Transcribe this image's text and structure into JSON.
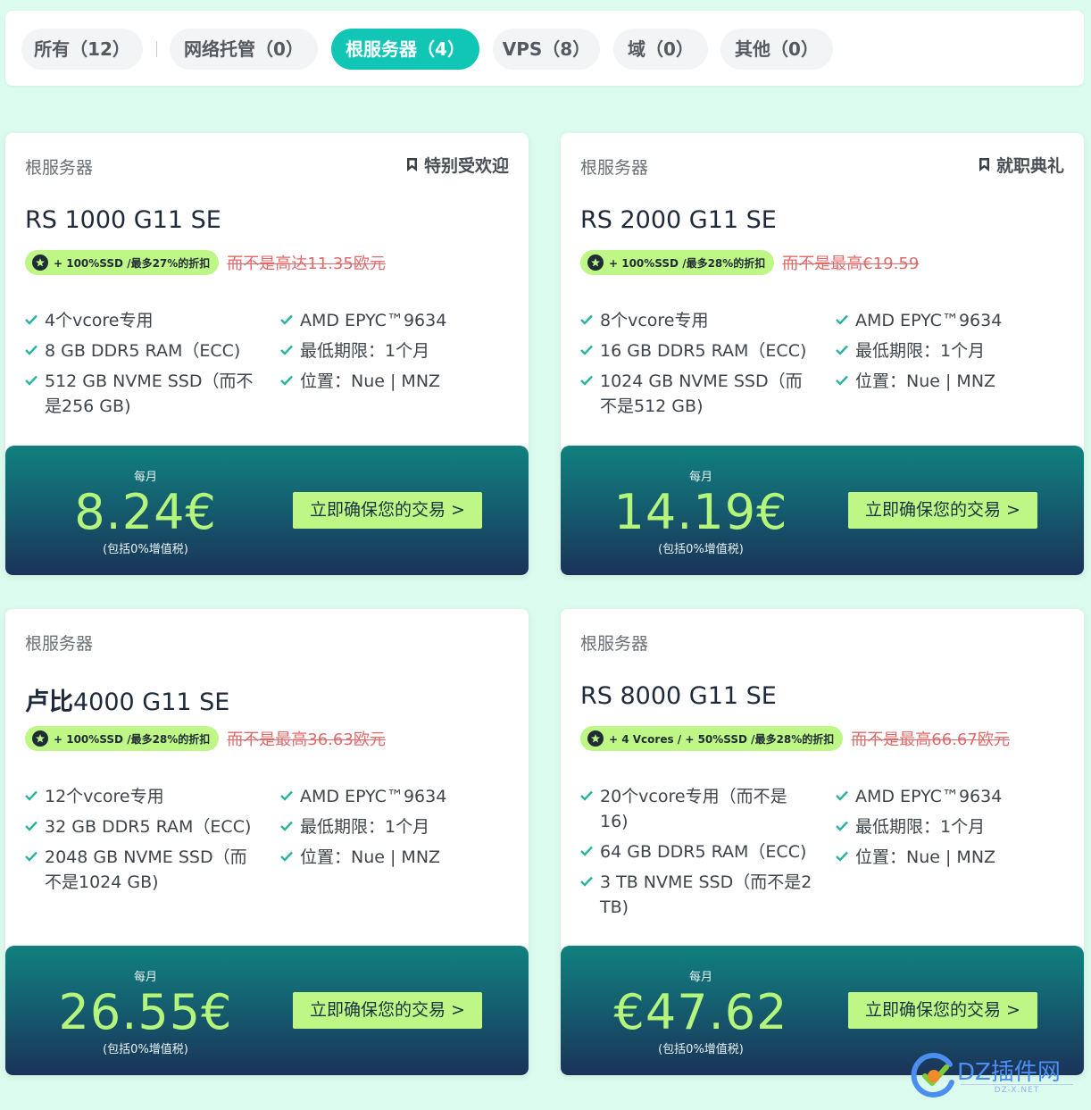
{
  "filters": [
    {
      "label": "所有（12）",
      "active": false
    },
    {
      "label": "网络托管（0）",
      "active": false
    },
    {
      "label": "根服务器（4）",
      "active": true
    },
    {
      "label": "VPS（8）",
      "active": false
    },
    {
      "label": "域（0）",
      "active": false
    },
    {
      "label": "其他（0）",
      "active": false
    }
  ],
  "cards": [
    {
      "category": "根服务器",
      "badge": "特别受欢迎",
      "title_bold": "",
      "title": "RS 1000 G11 SE",
      "promo": "+ 100%SSD /最多27%的折扣",
      "old_price": "而不是高达11.35欧元",
      "features_left": [
        "4个vcore专用",
        "8 GB DDR5 RAM（ECC)",
        "512 GB NVME SSD（而不是256 GB)"
      ],
      "features_right": [
        "AMD EPYC™9634",
        "最低期限：1个月",
        "位置：Nue | MNZ"
      ],
      "period": "每月",
      "price": "8.24€",
      "vat": "(包括0%增值税)",
      "cta": "立即确保您的交易 >"
    },
    {
      "category": "根服务器",
      "badge": "就职典礼",
      "title_bold": "",
      "title": "RS 2000 G11 SE",
      "promo": "+ 100%SSD /最多28%的折扣",
      "old_price": "而不是最高€19.59",
      "features_left": [
        "8个vcore专用",
        "16 GB DDR5 RAM（ECC)",
        "1024 GB NVME SSD（而不是512 GB)"
      ],
      "features_right": [
        "AMD EPYC™9634",
        "最低期限：1个月",
        "位置：Nue | MNZ"
      ],
      "period": "每月",
      "price": "14.19€",
      "vat": "(包括0%增值税)",
      "cta": "立即确保您的交易 >"
    },
    {
      "category": "根服务器",
      "badge": "",
      "title_bold": "卢比",
      "title": "4000 G11 SE",
      "promo": "+ 100%SSD /最多28%的折扣",
      "old_price": "而不是最高36.63欧元",
      "features_left": [
        "12个vcore专用",
        "32 GB DDR5 RAM（ECC)",
        "2048 GB NVME SSD（而不是1024 GB)"
      ],
      "features_right": [
        "AMD EPYC™9634",
        "最低期限：1个月",
        "位置：Nue | MNZ"
      ],
      "period": "每月",
      "price": "26.55€",
      "vat": "(包括0%增值税)",
      "cta": "立即确保您的交易 >"
    },
    {
      "category": "根服务器",
      "badge": "",
      "title_bold": "",
      "title": "RS 8000 G11 SE",
      "promo": "+ 4 Vcores / + 50%SSD /最多28%的折扣",
      "old_price": "而不是最高66.67欧元",
      "features_left": [
        "20个vcore专用（而不是16)",
        "64 GB DDR5 RAM（ECC)",
        "3 TB NVME SSD（而不是2 TB)"
      ],
      "features_right": [
        "AMD EPYC™9634",
        "最低期限：1个月",
        "位置：Nue | MNZ"
      ],
      "period": "每月",
      "price": "€47.62",
      "vat": "(包括0%增值税)",
      "cta": "立即确保您的交易 >"
    }
  ],
  "watermark": {
    "title": "DZ插件网",
    "subtitle": "DZ-X.NET"
  },
  "colors": {
    "accent": "#12c6b6",
    "promo": "#bff787",
    "price": "#b6f57c",
    "strike": "#e06a6a"
  }
}
